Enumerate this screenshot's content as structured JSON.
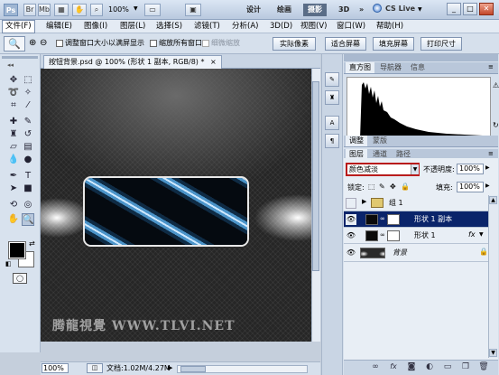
{
  "titlebar": {
    "app_logo": "Ps",
    "buttons": [
      "Br",
      "Mb"
    ],
    "zoom": "100%",
    "workspaces": [
      "设计",
      "绘画",
      "摄影",
      "3D"
    ],
    "active_workspace": "摄影",
    "more": "»",
    "cslive": "CS Live"
  },
  "menu": {
    "items": [
      "文件(F)",
      "编辑(E)",
      "图像(I)",
      "图层(L)",
      "选择(S)",
      "滤镜(T)",
      "分析(A)",
      "3D(D)",
      "视图(V)",
      "窗口(W)",
      "帮助(H)"
    ]
  },
  "options": {
    "resize_windows": "调整窗口大小以满屏显示",
    "zoom_all": "缩放所有窗口",
    "scrubby_zoom": "细微缩放",
    "actual_pixels": "实际像素",
    "fit_screen": "适合屏幕",
    "fill_screen": "填充屏幕",
    "print_size": "打印尺寸"
  },
  "document": {
    "tab_title": "按钮背景.psd @ 100% (形状 1 副本, RGB/8) *",
    "tab_close": "×",
    "watermark": "腾龍視覺 WWW.TLVI.NET",
    "zoom": "100%",
    "doc_info": "文档:1.02M/4.27M"
  },
  "histogram_panel": {
    "tabs": [
      "直方图",
      "导航器",
      "信息"
    ],
    "active": "直方图"
  },
  "adjust_panel": {
    "tabs": [
      "调整",
      "蒙版"
    ]
  },
  "layers_panel": {
    "tabs": [
      "图层",
      "通道",
      "路径"
    ],
    "active": "图层",
    "blend_mode": "颜色减淡",
    "opacity_label": "不透明度:",
    "opacity_value": "100%",
    "lock_label": "锁定:",
    "fill_label": "填充:",
    "fill_value": "100%",
    "layers": [
      {
        "name": "组 1",
        "type": "group",
        "selected": false,
        "visible": false
      },
      {
        "name": "形状 1 副本",
        "type": "shape",
        "selected": true,
        "visible": true
      },
      {
        "name": "形状 1",
        "type": "shape",
        "selected": false,
        "visible": true,
        "fx": "fx"
      },
      {
        "name": "背景",
        "type": "background",
        "selected": false,
        "visible": true
      }
    ]
  },
  "colors": {
    "selection_blue": "#0a246a",
    "blend_outline": "#b01414",
    "panel_bg": "#d6e0ec"
  }
}
